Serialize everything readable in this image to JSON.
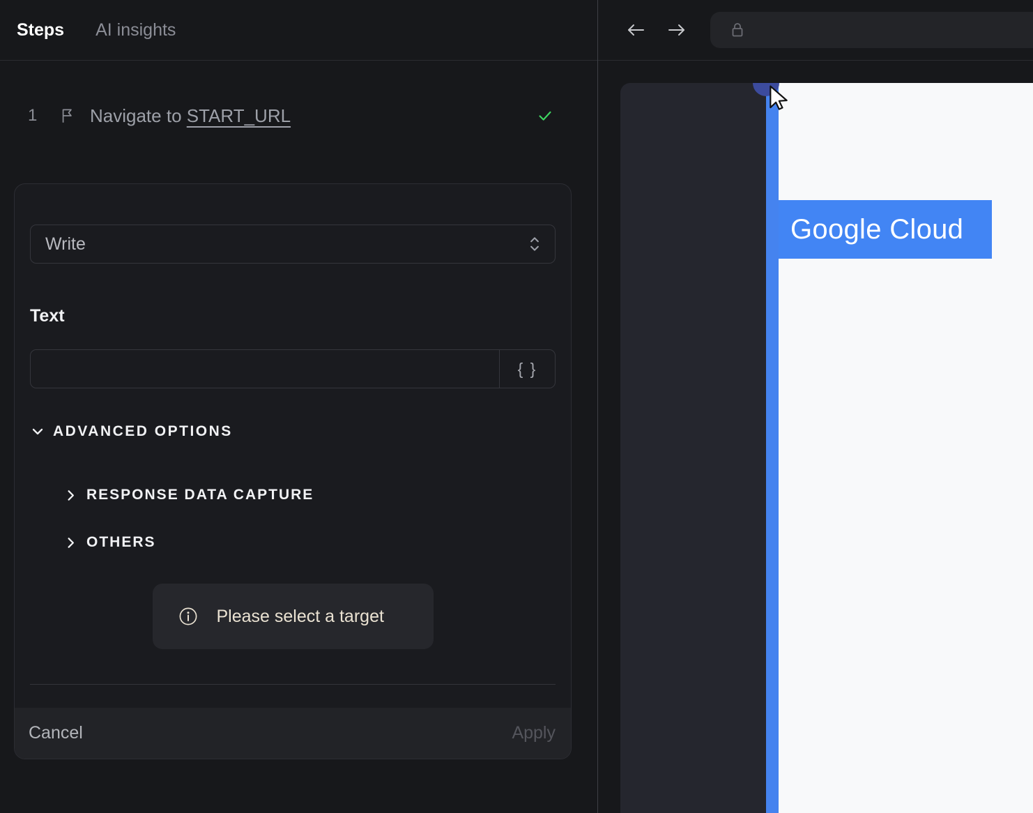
{
  "left_panel": {
    "tabs": [
      {
        "label": "Steps",
        "active": true
      },
      {
        "label": "AI insights",
        "active": false
      }
    ],
    "step": {
      "number": "1",
      "text": "Navigate to",
      "link_text": "START_URL",
      "status": "passed"
    },
    "form": {
      "action_select": {
        "value": "Write"
      },
      "text_label": "Text",
      "text_input": {
        "value": "",
        "placeholder": ""
      },
      "variable_button_label": "{ }",
      "advanced_options_label": "ADVANCED OPTIONS",
      "sections": [
        {
          "label": "RESPONSE DATA CAPTURE"
        },
        {
          "label": "OTHERS"
        }
      ],
      "info_message": "Please select a target",
      "cancel_label": "Cancel",
      "apply_label": "Apply"
    }
  },
  "browser": {
    "url_value": "",
    "page": {
      "brand_label": "Google Cloud"
    }
  },
  "icons": {
    "flag": "flag-outline",
    "check": "green-checkmark",
    "select_caret": "chevron-up-down",
    "advanced_caret": "chevron-down",
    "section_caret": "chevron-right",
    "info": "info-circle",
    "back": "arrow-left",
    "forward": "arrow-right",
    "lock": "padlock",
    "cursor": "mouse-pointer"
  },
  "colors": {
    "accent_blue": "#4285f4",
    "strip_blue": "#4583ef",
    "navy_dot": "#3c4b9d",
    "success_green": "#3ed661",
    "info_cream": "#eae2d2",
    "panel_bg": "#17181b",
    "card_bg": "#1a1b1f",
    "page_bg": "#f8f9fa"
  }
}
